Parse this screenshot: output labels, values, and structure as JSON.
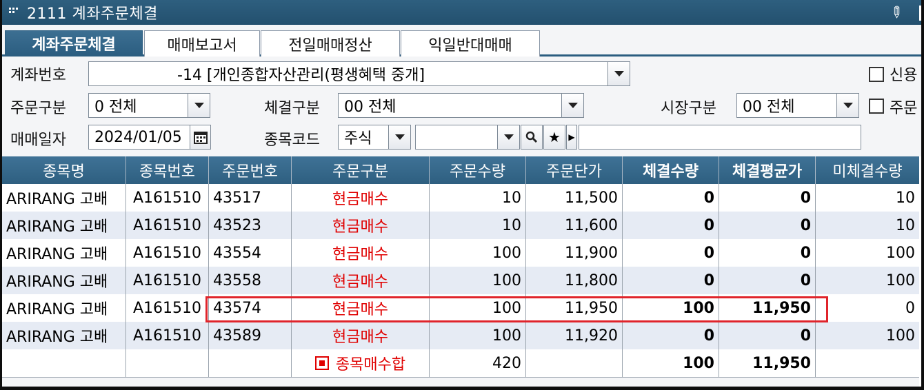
{
  "window": {
    "title": "2111 계좌주문체결"
  },
  "tabs": [
    {
      "label": "계좌주문체결",
      "active": true
    },
    {
      "label": "매매보고서",
      "active": false
    },
    {
      "label": "전일매매정산",
      "active": false
    },
    {
      "label": "익일반대매매",
      "active": false
    }
  ],
  "filters": {
    "account_label": "계좌번호",
    "account_value": "-14 [개인종합자산관리(평생혜택 중개]",
    "credit_label": "신용",
    "order_type_label": "주문구분",
    "order_type_value": "0 전체",
    "exec_type_label": "체결구분",
    "exec_type_value": "00 전체",
    "market_label": "시장구분",
    "market_value": "00 전체",
    "order_check_label": "주문",
    "trade_date_label": "매매일자",
    "trade_date_value": "2024/01/05",
    "code_label": "종목코드",
    "code_type_value": "주식",
    "code_value": ""
  },
  "grid": {
    "headers": [
      "종목명",
      "종목번호",
      "주문번호",
      "주문구분",
      "주문수량",
      "주문단가",
      "체결수량",
      "체결평균가",
      "미체결수량"
    ],
    "rows": [
      [
        "ARIRANG 고배",
        "A161510",
        "43517",
        "현금매수",
        "10",
        "11,500",
        "0",
        "0",
        "10"
      ],
      [
        "ARIRANG 고배",
        "A161510",
        "43523",
        "현금매수",
        "10",
        "11,600",
        "0",
        "0",
        "10"
      ],
      [
        "ARIRANG 고배",
        "A161510",
        "43554",
        "현금매수",
        "100",
        "11,900",
        "0",
        "0",
        "100"
      ],
      [
        "ARIRANG 고배",
        "A161510",
        "43558",
        "현금매수",
        "100",
        "11,800",
        "0",
        "0",
        "100"
      ],
      [
        "ARIRANG 고배",
        "A161510",
        "43574",
        "현금매수",
        "100",
        "11,950",
        "100",
        "11,950",
        "0"
      ],
      [
        "ARIRANG 고배",
        "A161510",
        "43589",
        "현금매수",
        "100",
        "11,920",
        "0",
        "0",
        "100"
      ]
    ],
    "summary": {
      "label": "종목매수합",
      "order_qty": "420",
      "exec_qty": "100",
      "avg_price": "11,950"
    }
  }
}
